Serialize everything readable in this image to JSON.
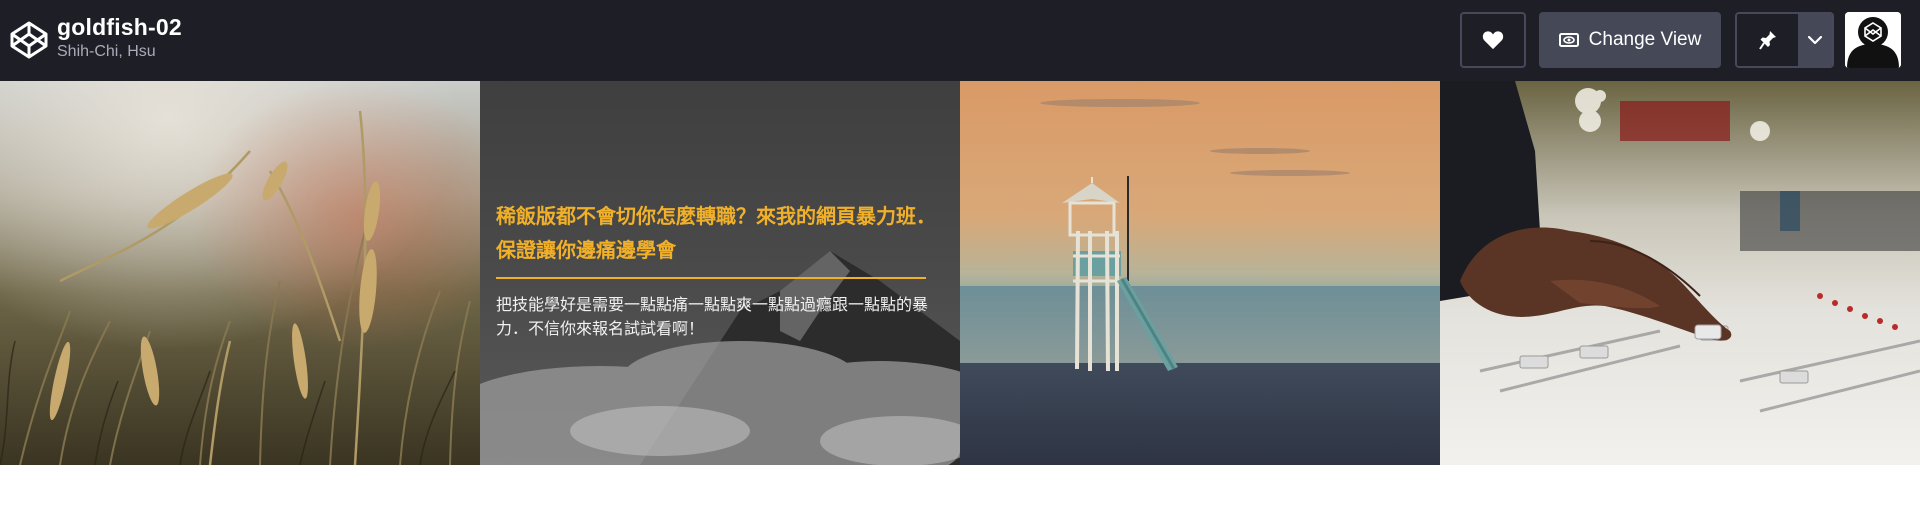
{
  "header": {
    "title": "goldfish-02",
    "author": "Shih-Chi, Hsu",
    "change_view_label": "Change View",
    "logo_icon": "codepen-logo-icon",
    "heart_icon": "heart-icon",
    "view_icon": "eye-icon",
    "pin_icon": "pin-icon",
    "caret_icon": "chevron-down-icon"
  },
  "panels": [
    {
      "name": "wheat-field-image"
    },
    {
      "name": "mountain-clouds-image",
      "title": "稀飯版都不會切你怎麼轉職？來我的網頁暴力班．保證讓你邊痛邊學會",
      "description": "把技能學好是需要一點點痛一點點爽一點點過癮跟一點點的暴力．不信你來報名試試看啊！"
    },
    {
      "name": "lifeguard-tower-image"
    },
    {
      "name": "mixing-console-image"
    }
  ],
  "colors": {
    "topbar_bg": "#1e1f26",
    "accent_yellow": "#f0b02a",
    "button_gray": "#444857"
  }
}
